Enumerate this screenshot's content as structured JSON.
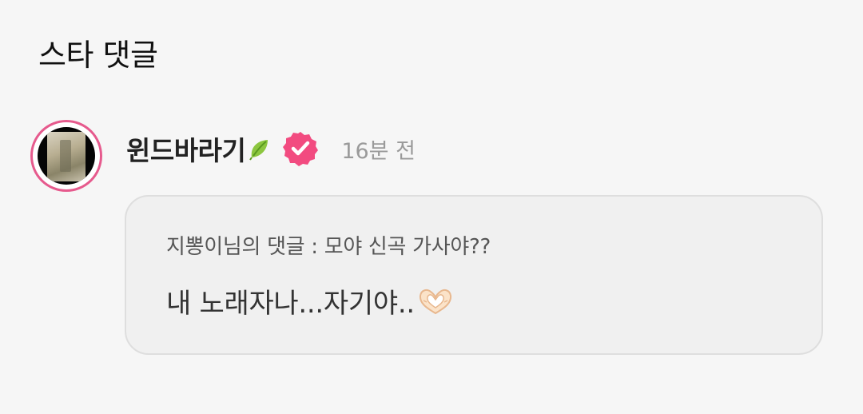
{
  "section": {
    "title": "스타 댓글"
  },
  "comment": {
    "username": "윈드바라기",
    "username_emoji": "leaf-icon",
    "verified_badge": "verified-icon",
    "timestamp": "16분 전",
    "reply_reference": "지뽕이님의 댓글 : 모야 신곡 가사야??",
    "reply_text": "내 노래자나...자기야..",
    "reply_emoji": "heart-hands-icon"
  },
  "colors": {
    "background": "#f6f6f6",
    "avatar_ring": "#e65a8d",
    "verified_badge": "#f24b80",
    "bubble_background": "#f0f0f0",
    "bubble_border": "#dedede",
    "timestamp": "#9a9a9a"
  }
}
